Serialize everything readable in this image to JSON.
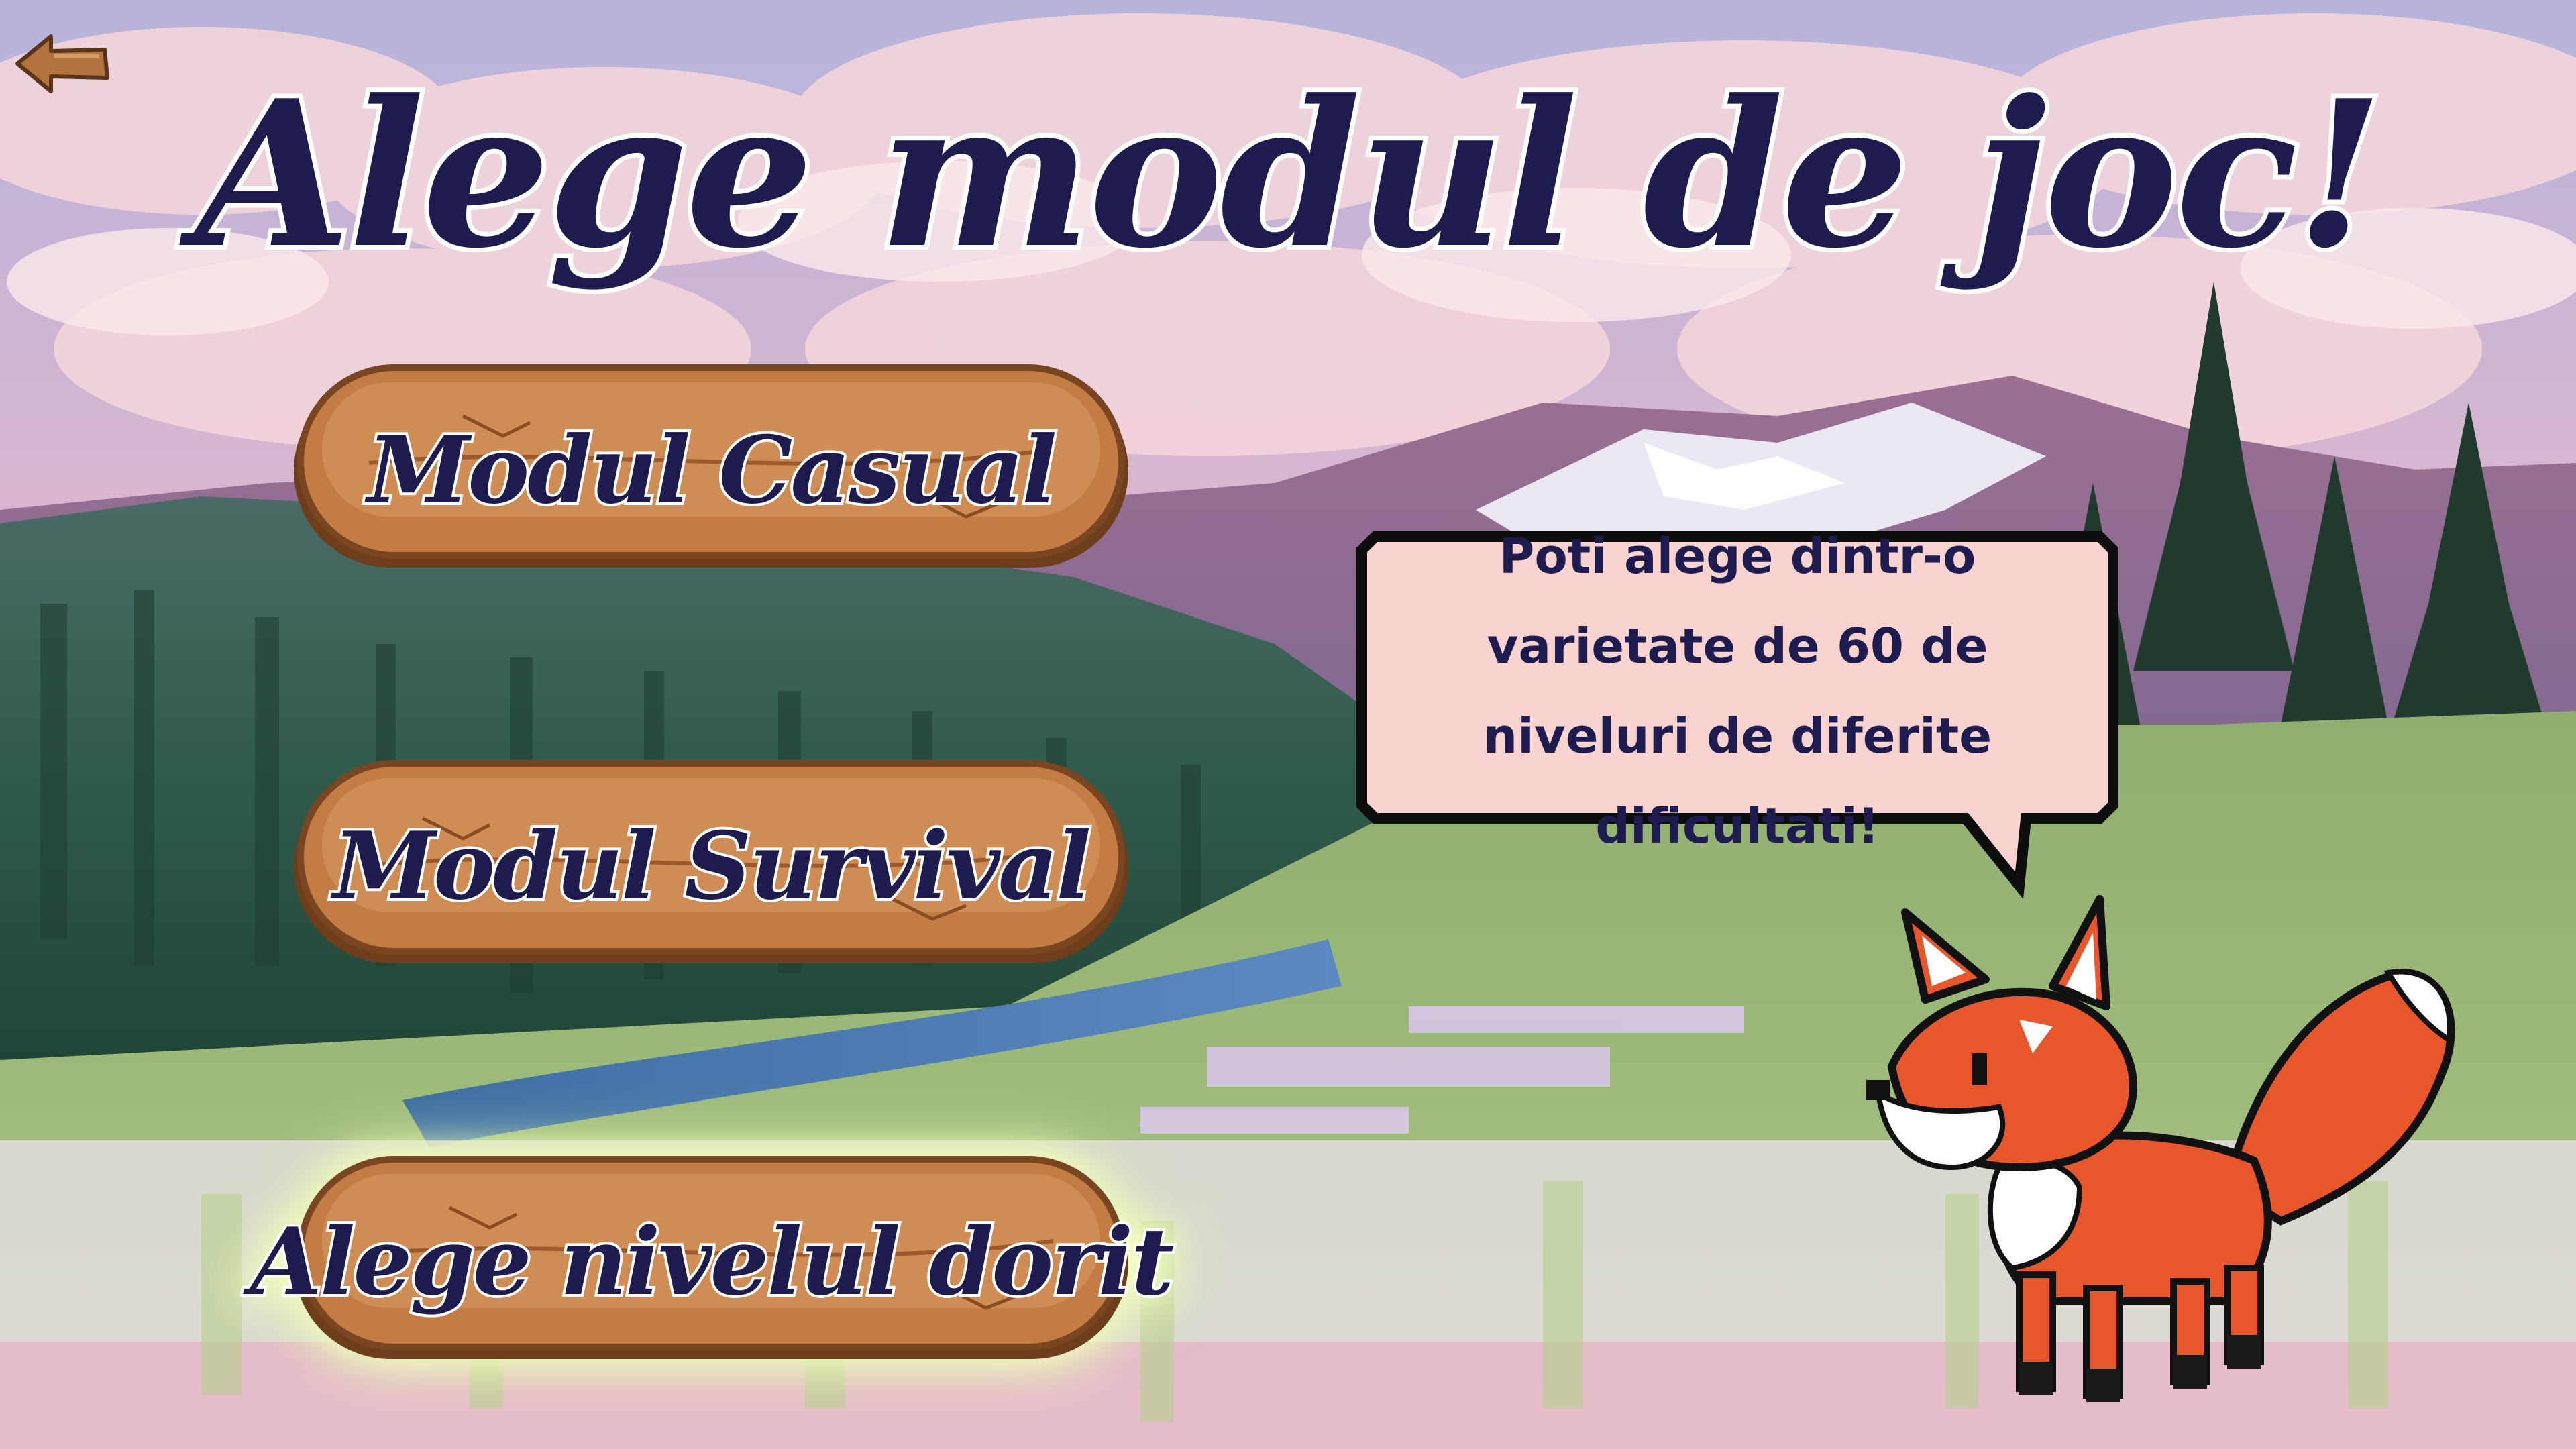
{
  "title": "Alege modul de joc!",
  "back_button_label": "",
  "modes": [
    {
      "label": "Modul Casual"
    },
    {
      "label": "Modul Survival"
    },
    {
      "label": "Alege nivelul dorit"
    }
  ],
  "tooltip": {
    "text": "Poti alege dintr-o varietate de 60 de niveluri de diferite dificultati!"
  },
  "colors": {
    "title_fill": "#1e1b4e",
    "title_outline": "#ffffff",
    "plank_wood": "#c47c45",
    "bubble_fill": "#f9d3cf",
    "fox_orange": "#e8572c"
  },
  "icons": {
    "back": "wooden-arrow-left-icon",
    "mascot": "fox-mascot"
  }
}
